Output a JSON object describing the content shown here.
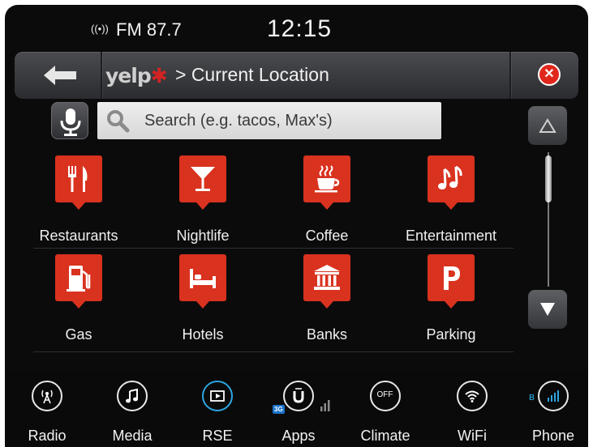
{
  "status": {
    "radio_label": "FM 87.7",
    "radio_icon": "antenna-icon",
    "clock": "12:15"
  },
  "titlebar": {
    "logo_text": "yelp",
    "title": "> Current Location",
    "back_icon": "back-arrow-icon",
    "close_icon": "close-icon"
  },
  "search": {
    "placeholder": "Search (e.g. tacos, Max's)",
    "mic_icon": "microphone-icon",
    "search_icon": "search-icon"
  },
  "categories": [
    {
      "label": "Restaurants",
      "icon": "fork-knife-icon"
    },
    {
      "label": "Nightlife",
      "icon": "cocktail-icon"
    },
    {
      "label": "Coffee",
      "icon": "coffee-cup-icon"
    },
    {
      "label": "Entertainment",
      "icon": "music-note-icon"
    },
    {
      "label": "Gas",
      "icon": "gas-pump-icon"
    },
    {
      "label": "Hotels",
      "icon": "bed-icon"
    },
    {
      "label": "Banks",
      "icon": "bank-icon"
    },
    {
      "label": "Parking",
      "icon": "parking-icon"
    }
  ],
  "dock": [
    {
      "label": "Radio",
      "icon": "radio-icon"
    },
    {
      "label": "Media",
      "icon": "music-note-icon"
    },
    {
      "label": "RSE",
      "icon": "play-screen-icon"
    },
    {
      "label": "Apps",
      "icon": "uconnect-icon",
      "badge": "3G"
    },
    {
      "label": "Climate",
      "icon": "off-icon",
      "icon_text": "OFF"
    },
    {
      "label": "WiFi",
      "icon": "wifi-icon"
    },
    {
      "label": "Phone",
      "icon": "phone-signal-icon"
    }
  ],
  "colors": {
    "accent_red": "#d9321f",
    "rse_highlight": "#2da6e0",
    "background": "#0b0b0c"
  }
}
